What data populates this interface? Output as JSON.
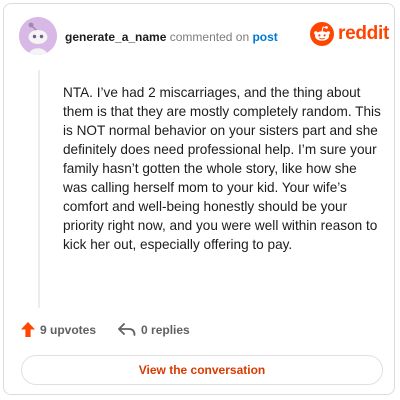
{
  "header": {
    "username": "generate_a_name",
    "commented_on": "commented on",
    "post_link": "post"
  },
  "logo": {
    "wordmark": "reddit",
    "icon": "reddit-snoo-icon",
    "brand_color": "#ff4500"
  },
  "avatar": {
    "icon": "snoo-avatar-icon",
    "background": "#d7b8e6"
  },
  "comment": {
    "text": "NTA. I’ve had 2 miscarriages, and the thing about them is that they are mostly completely random. This is NOT normal behavior on your sisters part and she definitely does need professional help. I’m sure your family hasn’t gotten the whole story, like how she was calling herself mom to your kid. Your wife’s comfort and well-being honestly should be your priority right now, and you were well within reason to kick her out, especially offering to pay."
  },
  "actions": {
    "upvotes_label": "9 upvotes",
    "upvote_icon": "upvote-arrow-icon",
    "upvote_color": "#ff4500",
    "replies_label": "0 replies",
    "reply_icon": "reply-arrow-icon"
  },
  "cta": {
    "label": "View the conversation",
    "color": "#d93a00"
  }
}
